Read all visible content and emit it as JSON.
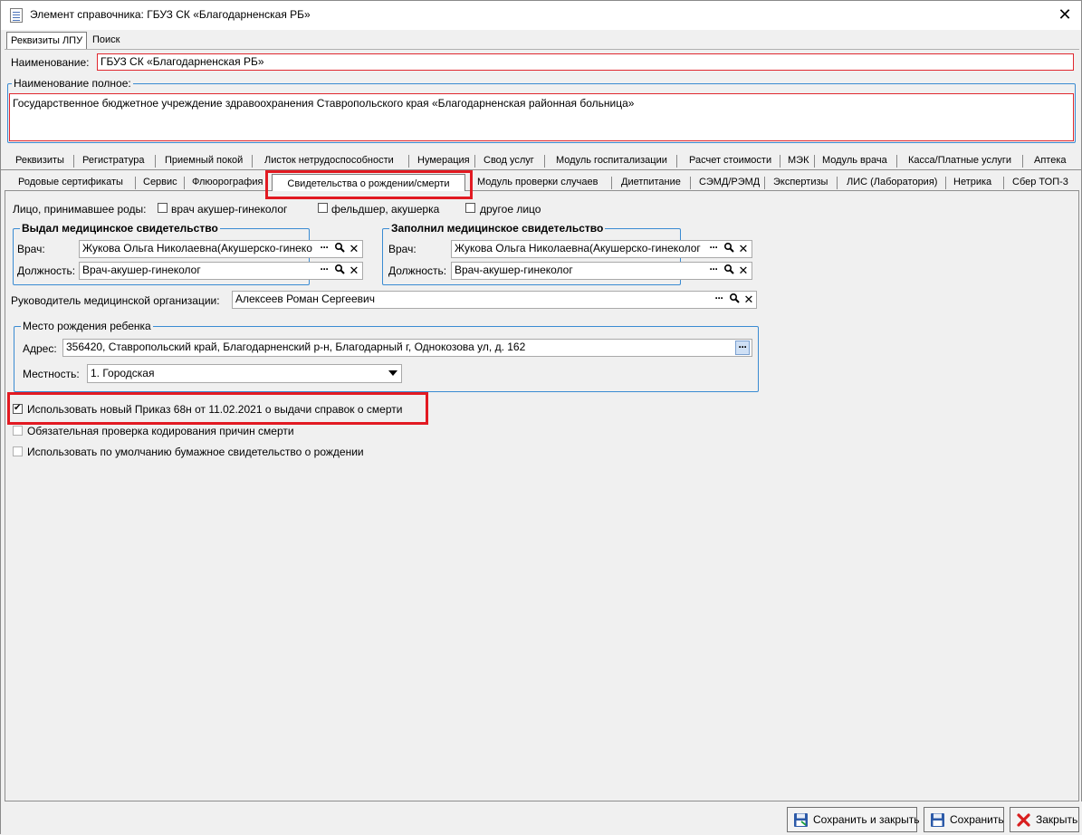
{
  "window": {
    "title": "Элемент справочника: ГБУЗ СК «Благодарненская РБ»"
  },
  "top_tabs": [
    "Реквизиты ЛПУ",
    "Поиск"
  ],
  "name_label": "Наименование:",
  "name_value": "ГБУЗ СК «Благодарненская РБ»",
  "full_name_label": "Наименование полное:",
  "full_name_value": "Государственное бюджетное учреждение здравоохранения Ставропольского края «Благодарненская районная больница»",
  "tabs_row1": [
    "Реквизиты",
    "Регистратура",
    "Приемный покой",
    "Листок нетрудоспособности",
    "Нумерация",
    "Свод услуг",
    "Модуль госпитализации",
    "Расчет стоимости",
    "МЭК",
    "Модуль врача",
    "Касса/Платные услуги",
    "Аптека"
  ],
  "tabs_row2": [
    "Родовые сертификаты",
    "Сервис",
    "Флюорография",
    "Свидетельства о рождении/смерти",
    "Модуль проверки случаев",
    "Диетпитание",
    "СЭМД/РЭМД",
    "Экспертизы",
    "ЛИС (Лаборатория)",
    "Нетрика",
    "Сбер ТОП-3"
  ],
  "birth_person": {
    "label": "Лицо, принимавшее роды:",
    "options": [
      "врач акушер-гинеколог",
      "фельдшер, акушерка",
      "другое лицо"
    ]
  },
  "issued": {
    "legend": "Выдал медицинское свидетельство",
    "doctor_label": "Врач:",
    "doctor_value": "Жукова Ольга Николаевна(Акушерско-гинеко",
    "position_label": "Должность:",
    "position_value": "Врач-акушер-гинеколог"
  },
  "filled": {
    "legend": "Заполнил медицинское свидетельство",
    "doctor_label": "Врач:",
    "doctor_value": "Жукова Ольга Николаевна(Акушерско-гинеколог",
    "position_label": "Должность:",
    "position_value": "Врач-акушер-гинеколог"
  },
  "head": {
    "label": "Руководитель медицинской организации:",
    "value": "Алексеев Роман Сергеевич"
  },
  "birthplace": {
    "legend": "Место рождения ребенка",
    "address_label": "Адрес:",
    "address_value": "356420, Ставропольский край, Благодарненский р-н, Благодарный г, Однокозова ул, д. 162",
    "locality_label": "Местность:",
    "locality_value": "1. Городская"
  },
  "checkboxes": [
    {
      "label": "Использовать новый Приказ 68н от 11.02.2021 о выдачи справок о смерти",
      "checked": true
    },
    {
      "label": "Обязательная проверка кодирования причин смерти",
      "checked": false
    },
    {
      "label": "Использовать по умолчанию бумажное свидетельство о рождении",
      "checked": false
    }
  ],
  "buttons": {
    "save_close": "Сохранить и закрыть",
    "save": "Сохранить",
    "close": "Закрыть"
  },
  "icons": {
    "dots": "ellipsis-icon",
    "search": "magnifier-icon",
    "clear": "clear-x-icon",
    "save": "floppy-disk-icon",
    "close": "red-x-icon"
  }
}
